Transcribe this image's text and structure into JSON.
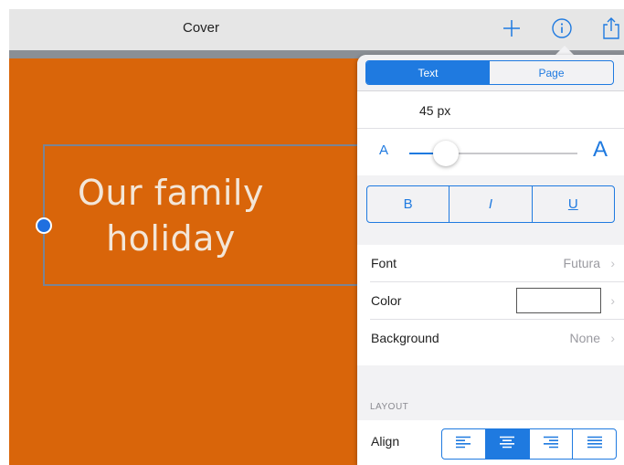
{
  "navbar": {
    "title": "Cover",
    "add_icon": "plus-icon",
    "info_icon": "info-icon",
    "share_icon": "share-icon"
  },
  "canvas": {
    "text_line1": "Our family",
    "text_line2": "holiday",
    "background_color": "#d9650a"
  },
  "inspector": {
    "tabs": [
      {
        "label": "Text",
        "active": true
      },
      {
        "label": "Page",
        "active": false
      }
    ],
    "font_size_label": "45 px",
    "slider": {
      "small_label": "A",
      "large_label": "A",
      "value_fraction": 0.22
    },
    "style_buttons": [
      "B",
      "I",
      "U"
    ],
    "font": {
      "label": "Font",
      "value": "Futura"
    },
    "color": {
      "label": "Color",
      "swatch": "#ffffff"
    },
    "background": {
      "label": "Background",
      "value": "None"
    },
    "chevron": "›",
    "layout_header": "LAYOUT",
    "align": {
      "label": "Align",
      "options": [
        "align-left",
        "align-center",
        "align-right",
        "align-justify"
      ],
      "selected": "align-center"
    }
  },
  "colors": {
    "accent": "#1f7ae0",
    "canvas": "#d9650a"
  }
}
